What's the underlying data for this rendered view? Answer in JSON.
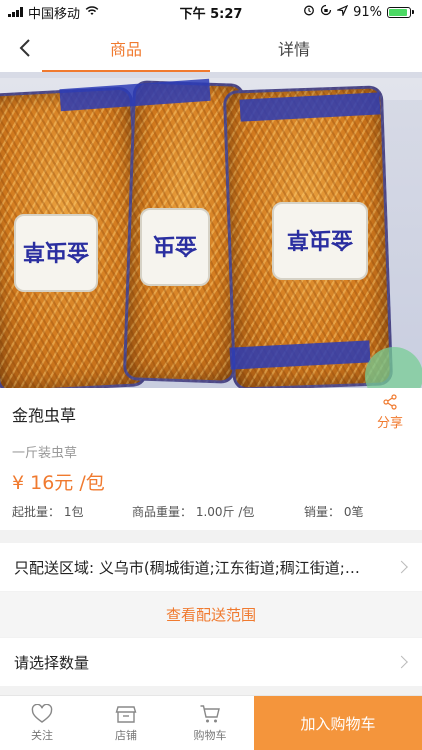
{
  "status_bar": {
    "carrier": "中国移动",
    "time": "下午 5:27",
    "battery": "91%",
    "battery_level": 0.91
  },
  "nav": {
    "tab_goods": "商品",
    "tab_detail": "详情"
  },
  "product": {
    "name": "金孢虫草",
    "subtitle": "一斤装虫草",
    "price": "¥ 16元 /包",
    "min_order": "起批量： 1包",
    "weight": "商品重量： 1.00斤 /包",
    "sales": "销量： 0笔",
    "share_label": "分享"
  },
  "delivery": {
    "region_text": "只配送区域: 义乌市(稠城街道;江东街道;稠江街道;北苑街道)",
    "view_range": "查看配送范围"
  },
  "quantity": {
    "label": "请选择数量"
  },
  "bottom_bar": {
    "follow": "关注",
    "shop": "店铺",
    "cart": "购物车",
    "add_to_cart": "加入购物车"
  },
  "colors": {
    "accent": "#f07a2f",
    "cart_button": "#f4953c"
  }
}
